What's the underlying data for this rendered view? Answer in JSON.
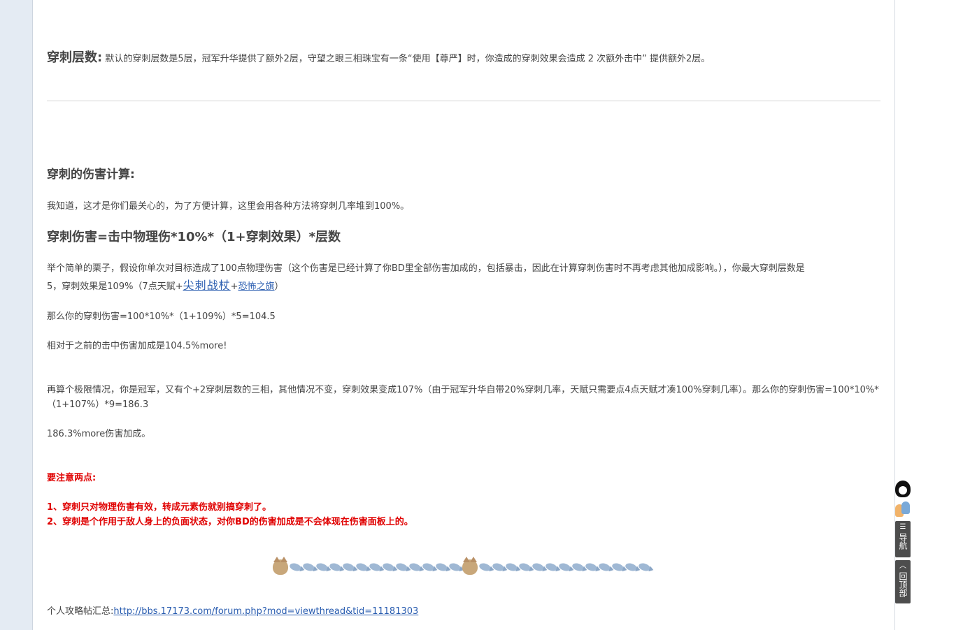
{
  "layers": {
    "heading": "穿刺层数:",
    "text": "默认的穿刺层数是5层，冠军升华提供了额外2层，守望之眼三相珠宝有一条“使用【尊严】时，你造成的穿刺效果会造成 2 次额外击中” 提供额外2层。"
  },
  "damage": {
    "heading": "穿刺的伤害计算:",
    "intro": "我知道，这才是你们最关心的，为了方便计算，这里会用各种方法将穿刺几率堆到100%。",
    "formula": "穿刺伤害=击中物理伤*10%*（1+穿刺效果）*层数",
    "example_line1": "举个简单的栗子，假设你单次对目标造成了100点物理伤害（这个伤害是已经计算了你BD里全部伤害加成的，包括暴击，因此在计算穿刺伤害时不再考虑其他加成影响。），你最大穿刺层数是",
    "example_line2_prefix": "5，穿刺效果是109%（7点天赋+",
    "example_link1": "尖刺战杖",
    "example_plus": "+",
    "example_link2": "恐怖之旗",
    "example_suffix": "）",
    "calc1": "那么你的穿刺伤害=100*10%*（1+109%）*5=104.5",
    "calc1_result": "相对于之前的击中伤害加成是104.5%more!",
    "extreme": "再算个极限情况，你是冠军，又有个+2穿刺层数的三相，其他情况不变，穿刺效果变成107%（由于冠军升华自带20%穿刺几率，天赋只需要点4点天赋才凑100%穿刺几率）。那么你的穿刺伤害=100*10%*（1+107%）*9=186.3",
    "extreme_result": "186.3%more伤害加成。"
  },
  "notes": {
    "heading": "要注意两点:",
    "item1": "1、穿刺只对物理伤害有效，转成元素伤就别搞穿刺了。",
    "item2": "2、穿刺是个作用于敌人身上的负面状态，对你BD的伤害加成是不会体现在伤害面板上的。"
  },
  "footer": {
    "label": "个人攻略帖汇总:",
    "link": "http://bbs.17173.com/forum.php?mod=viewthread&tid=11181303"
  },
  "sidebar_tools": {
    "nav_label": "导航",
    "top_label": "回顶部",
    "icons": [
      "qq-icon",
      "users-icon",
      "list-icon",
      "chevron-up-icon"
    ]
  },
  "decor_icons": [
    "cat-icon",
    "fish-icon"
  ]
}
